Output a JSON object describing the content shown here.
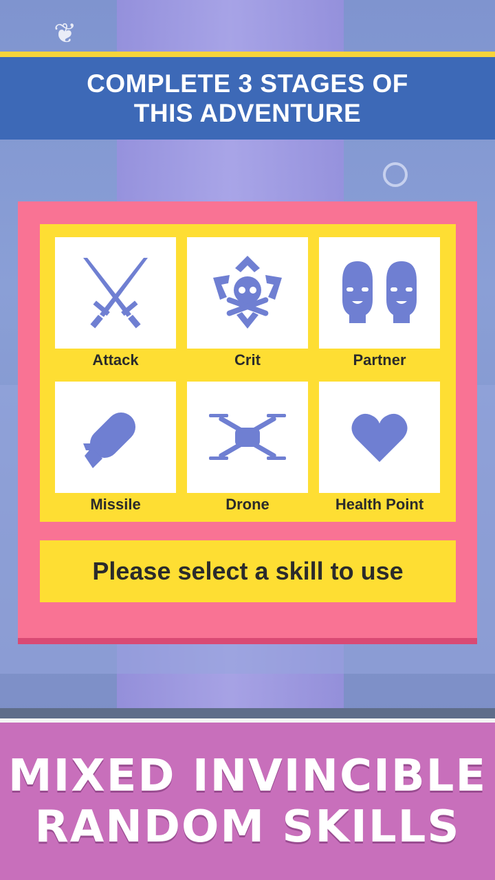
{
  "banner": {
    "line1": "COMPLETE 3 STAGES OF",
    "line2": "THIS ADVENTURE"
  },
  "skills": [
    {
      "label": "Attack",
      "icon": "crossed-swords-icon"
    },
    {
      "label": "Crit",
      "icon": "skull-crossbones-icon"
    },
    {
      "label": "Partner",
      "icon": "two-heads-icon"
    },
    {
      "label": "Missile",
      "icon": "missile-icon"
    },
    {
      "label": "Drone",
      "icon": "drone-icon"
    },
    {
      "label": "Health Point",
      "icon": "heart-icon"
    }
  ],
  "prompt": "Please select a skill to use",
  "caption": {
    "line1": "MIXED INVINCIBLE",
    "line2": "RANDOM SKILLS"
  },
  "colors": {
    "icon": "#6f7fd2",
    "banner": "#3d69b7",
    "panel": "#f97394",
    "panel_inner": "#fede33",
    "caption_bg": "#c86fbb"
  }
}
